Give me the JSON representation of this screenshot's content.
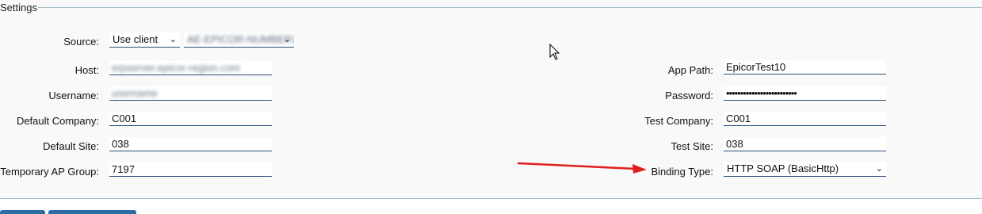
{
  "settings": {
    "legend": "Settings",
    "source": {
      "label": "Source:",
      "value": "Use client",
      "server_value": "AE-EPICOR-NUMBER1"
    },
    "host": {
      "label": "Host:",
      "value": "erpserver.epicor-region.com"
    },
    "username": {
      "label": "Username:",
      "value": "username"
    },
    "default_company": {
      "label": "Default Company:",
      "value": "C001"
    },
    "default_site": {
      "label": "Default Site:",
      "value": "038"
    },
    "temp_ap_group": {
      "label": "Temporary AP Group:",
      "value": "7197"
    },
    "app_path": {
      "label": "App Path:",
      "value": "EpicorTest10"
    },
    "password": {
      "label": "Password:",
      "value": "•••••••••••••••••••••••••"
    },
    "test_company": {
      "label": "Test Company:",
      "value": "C001"
    },
    "test_site": {
      "label": "Test Site:",
      "value": "038"
    },
    "binding_type": {
      "label": "Binding Type:",
      "value": "HTTP SOAP (BasicHttp)"
    }
  },
  "colors": {
    "accent": "#2d6da3",
    "border": "#a9bfc9",
    "arrow": "#e01e1e"
  },
  "icons": {
    "cursor": "mouse-pointer-icon",
    "dropdown": "chevron-down-icon"
  }
}
